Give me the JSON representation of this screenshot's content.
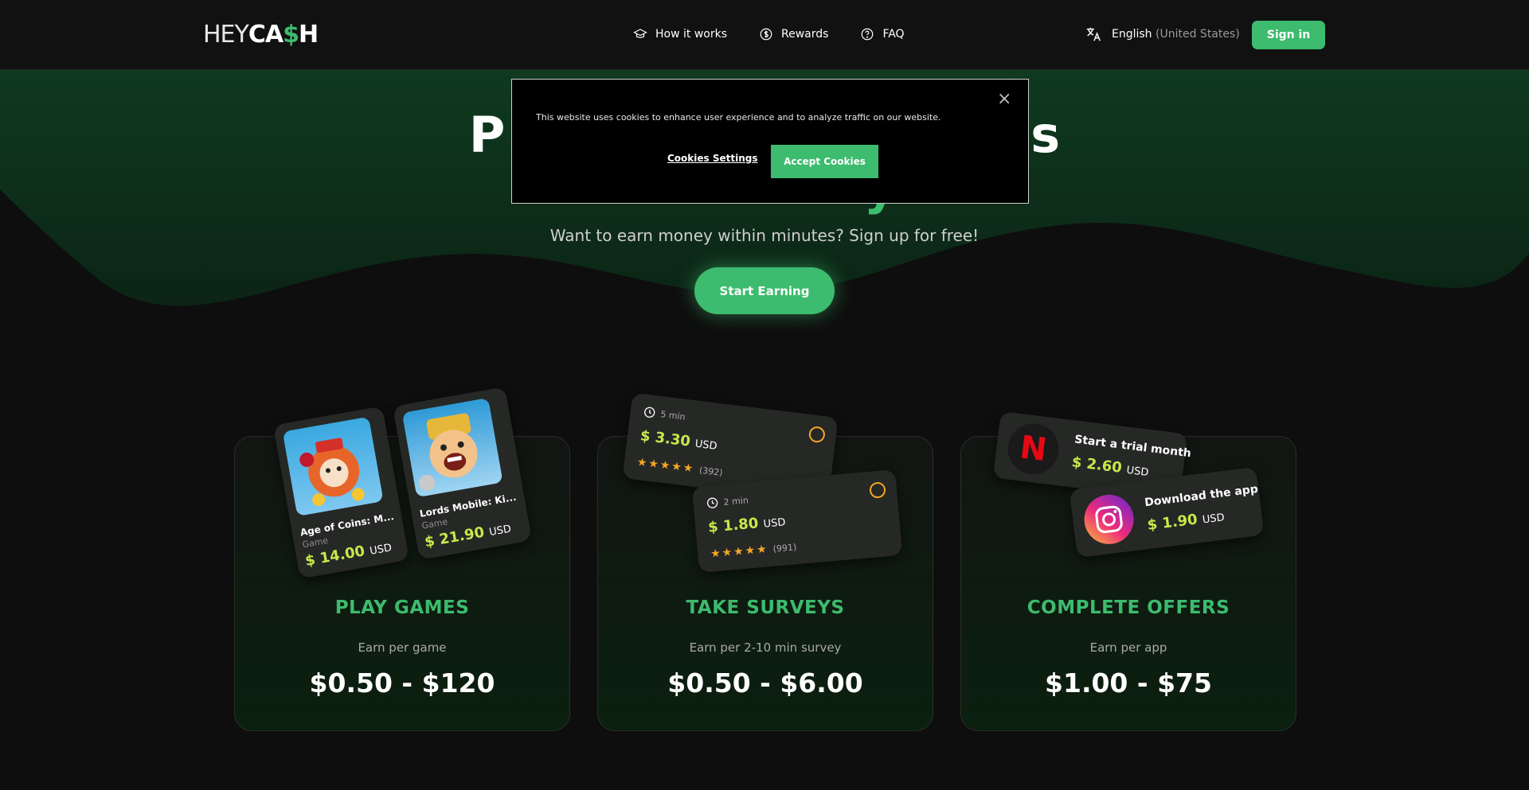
{
  "header": {
    "logo_left": "HEY",
    "logo_right_a": "CA",
    "logo_dollar": "$",
    "logo_right_b": "H",
    "nav": [
      {
        "label": "How it works",
        "icon": "graduation-cap-icon"
      },
      {
        "label": "Rewards",
        "icon": "dollar-circle-icon"
      },
      {
        "label": "FAQ",
        "icon": "question-circle-icon"
      }
    ],
    "language": "English",
    "language_region": "(United States)",
    "signin_label": "Sign in"
  },
  "hero": {
    "title_line1": "P",
    "title_line1_end": "s",
    "title_line2": "y",
    "subtitle": "Want to earn money within minutes? Sign up for free!",
    "cta_label": "Start Earning"
  },
  "cookie": {
    "text": "This website uses cookies to enhance user experience and to analyze traffic on our website.",
    "settings_label": "Cookies Settings",
    "accept_label": "Accept Cookies",
    "close_symbol": "×"
  },
  "cards": [
    {
      "title": "PLAY GAMES",
      "subtitle": "Earn per game",
      "range": "$0.50 - $120",
      "items": [
        {
          "name": "Age of Coins: M...",
          "category": "Game",
          "price": "$ 14.00",
          "unit": "USD"
        },
        {
          "name": "Lords Mobile: Ki...",
          "category": "Game",
          "price": "$ 21.90",
          "unit": "USD"
        }
      ]
    },
    {
      "title": "TAKE SURVEYS",
      "subtitle": "Earn per 2-10 min survey",
      "range": "$0.50 - $6.00",
      "items": [
        {
          "time": "5 min",
          "price": "$ 3.30",
          "unit": "USD",
          "stars": "★★★★★",
          "count": "(392)"
        },
        {
          "time": "2 min",
          "price": "$ 1.80",
          "unit": "USD",
          "stars": "★★★★★",
          "count": "(991)"
        }
      ]
    },
    {
      "title": "COMPLETE OFFERS",
      "subtitle": "Earn per app",
      "range": "$1.00 - $75",
      "items": [
        {
          "title": "Start a trial month",
          "price": "$ 2.60",
          "unit": "USD",
          "icon": "netflix-icon",
          "glyph": "N"
        },
        {
          "title": "Download the app",
          "price": "$ 1.90",
          "unit": "USD",
          "icon": "instagram-icon"
        }
      ]
    }
  ],
  "colors": {
    "accent": "#3dbb6e",
    "price": "#c8e84a",
    "star": "#f5a623",
    "background": "#0e0e0e"
  }
}
